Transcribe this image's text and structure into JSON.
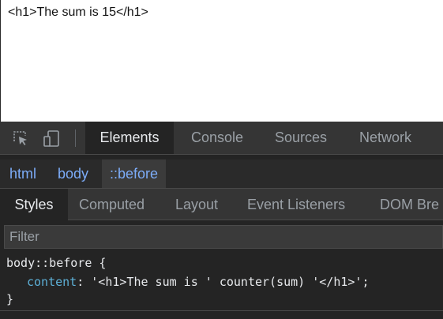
{
  "page": {
    "content_text": "<h1>The sum is 15</h1>"
  },
  "devtools": {
    "toolbar": {
      "inspect_icon": "inspect-element-icon",
      "device_icon": "device-toggle-icon",
      "tabs": [
        {
          "label": "Elements",
          "active": true
        },
        {
          "label": "Console",
          "active": false
        },
        {
          "label": "Sources",
          "active": false
        },
        {
          "label": "Network",
          "active": false
        }
      ]
    },
    "breadcrumb": [
      "html",
      "body",
      "::before"
    ],
    "subtabs": [
      {
        "label": "Styles",
        "active": true
      },
      {
        "label": "Computed",
        "active": false
      },
      {
        "label": "Layout",
        "active": false
      },
      {
        "label": "Event Listeners",
        "active": false
      },
      {
        "label": "DOM Bre",
        "active": false
      }
    ],
    "filter": {
      "placeholder": "Filter",
      "value": ""
    },
    "rule": {
      "selector_line": "body::before {",
      "property": "content",
      "separator": ": ",
      "value": "'<h1>The sum is ' counter(sum) '</h1>';",
      "close": "}"
    }
  },
  "colors": {
    "page_background": "#ffffff",
    "devtools_background": "#242424",
    "toolbar_background": "#353535",
    "link_blue": "#7cacf8",
    "property_name": "#5db0d7"
  }
}
